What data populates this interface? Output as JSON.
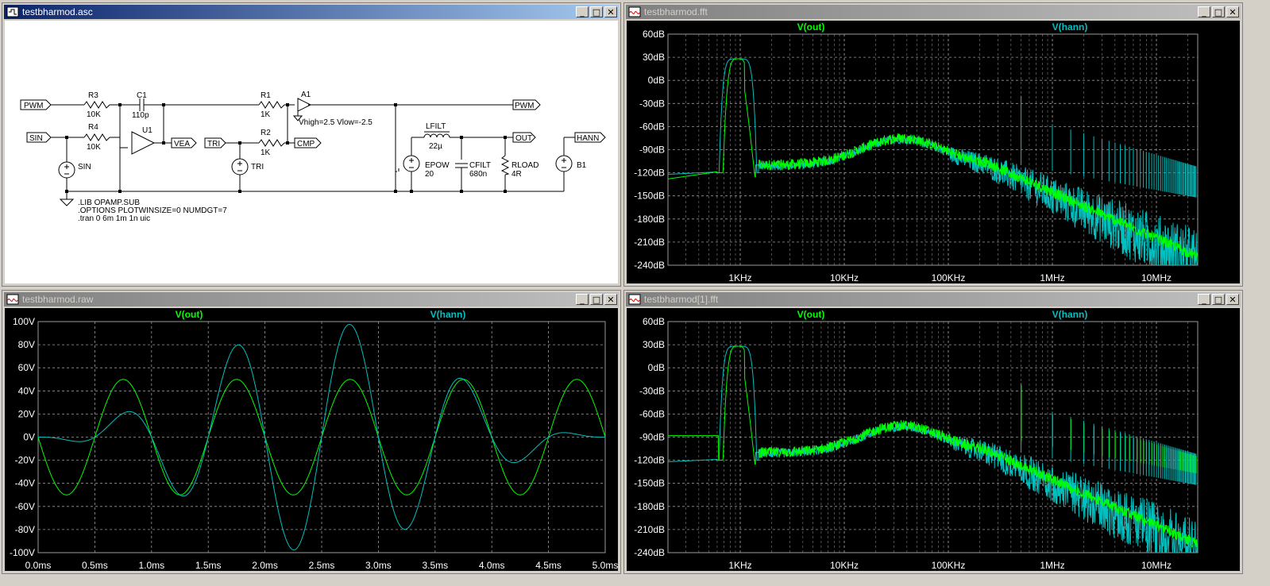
{
  "schematic": {
    "title": "testbharmod.asc",
    "labels": {
      "pwm_in": "PWM",
      "sin_in": "SIN",
      "r3": "R3",
      "r3v": "10K",
      "r4": "R4",
      "r4v": "10K",
      "c1": "C1",
      "c1v": "110p",
      "u1": "U1",
      "vea": "VEA",
      "sin_src": "SIN",
      "r1": "R1",
      "r1v": "1K",
      "a1": "A1",
      "a1params": "Vhigh=2.5 Vlow=-2.5",
      "tri": "TRI",
      "r2": "R2",
      "r2v": "1K",
      "cmp": "CMP",
      "tri_src": "TRI",
      "pwm_out": "PWM",
      "lfilt": "LFILT",
      "lfiltv": "22µ",
      "out": "OUT",
      "epow": "EPOW",
      "epowv": "20",
      "cfilt": "CFILT",
      "cfiltv": "680n",
      "rload": "RLOAD",
      "rloadv": "4R",
      "hann": "HANN",
      "b1": "B1",
      "dir1": ".LIB OPAMP.SUB",
      "dir2": ".OPTIONS PLOTWINSIZE=0 NUMDGT=7",
      "dir3": ".tran 0 6m 1m 1n uic"
    }
  },
  "fft1": {
    "title": "testbharmod.fft",
    "trace1": "V(out)",
    "trace2": "V(hann)",
    "yticks": [
      "60dB",
      "30dB",
      "0dB",
      "-30dB",
      "-60dB",
      "-90dB",
      "-120dB",
      "-150dB",
      "-180dB",
      "-210dB",
      "-240dB"
    ],
    "xticks": [
      "1KHz",
      "10KHz",
      "100KHz",
      "1MHz",
      "10MHz"
    ]
  },
  "raw": {
    "title": "testbharmod.raw",
    "trace1": "V(out)",
    "trace2": "V(hann)",
    "yticks": [
      "100V",
      "80V",
      "60V",
      "40V",
      "20V",
      "0V",
      "-20V",
      "-40V",
      "-60V",
      "-80V",
      "-100V"
    ],
    "xticks": [
      "0.0ms",
      "0.5ms",
      "1.0ms",
      "1.5ms",
      "2.0ms",
      "2.5ms",
      "3.0ms",
      "3.5ms",
      "4.0ms",
      "4.5ms",
      "5.0ms"
    ]
  },
  "fft2": {
    "title": "testbharmod[1].fft",
    "trace1": "V(out)",
    "trace2": "V(hann)",
    "yticks": [
      "60dB",
      "30dB",
      "0dB",
      "-30dB",
      "-60dB",
      "-90dB",
      "-120dB",
      "-150dB",
      "-180dB",
      "-210dB",
      "-240dB"
    ],
    "xticks": [
      "1KHz",
      "10KHz",
      "100KHz",
      "1MHz",
      "10MHz"
    ]
  },
  "colors": {
    "v_out": "#00ff00",
    "v_hann": "#00c0c0",
    "plot_bg": "#000000",
    "grid": "#9a9a9a",
    "axis_text": "#ffffff"
  },
  "window_buttons": {
    "minimize": "_",
    "maximize": "□",
    "close": "✕"
  }
}
